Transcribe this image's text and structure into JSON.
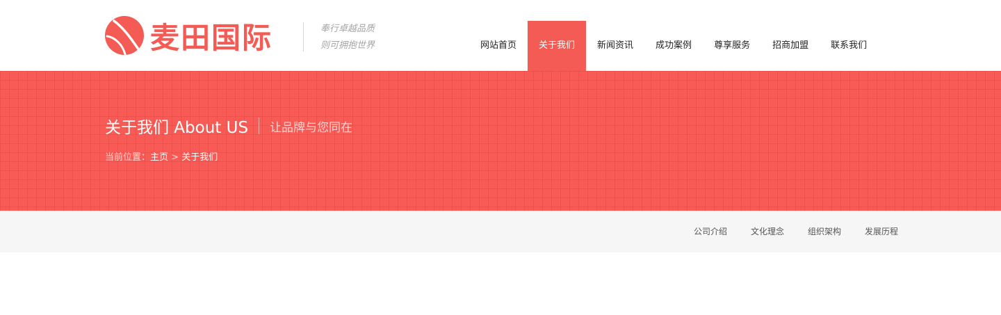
{
  "brand": {
    "logo_text": "麦田国际",
    "slogan_line1": "奉行卓越品质",
    "slogan_line2": "则可拥抱世界",
    "accent_color": "#f35b54"
  },
  "nav": {
    "items": [
      {
        "label": "网站首页",
        "active": false
      },
      {
        "label": "关于我们",
        "active": true
      },
      {
        "label": "新闻资讯",
        "active": false
      },
      {
        "label": "成功案例",
        "active": false
      },
      {
        "label": "尊享服务",
        "active": false
      },
      {
        "label": "招商加盟",
        "active": false
      },
      {
        "label": "联系我们",
        "active": false
      }
    ]
  },
  "banner": {
    "title": "关于我们 About US",
    "subtitle": "让品牌与您同在",
    "breadcrumb": {
      "prefix": "当前位置：",
      "home": "主页",
      "separator": " > ",
      "current": "关于我们"
    }
  },
  "subnav": {
    "items": [
      "公司介绍",
      "文化理念",
      "组织架构",
      "发展历程"
    ]
  }
}
